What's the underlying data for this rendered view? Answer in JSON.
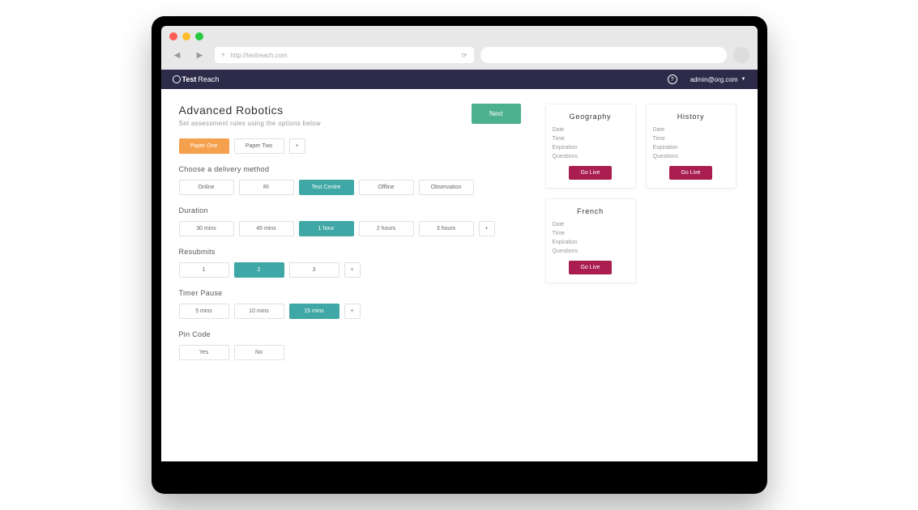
{
  "browser": {
    "url": "http://testreach.com"
  },
  "header": {
    "logo_bold": "Test",
    "logo_light": "Reach",
    "help": "?",
    "user": "admin@org.com"
  },
  "page": {
    "title": "Advanced Robotics",
    "subtitle": "Set assessment rules using the options below",
    "next_label": "Next"
  },
  "papers": {
    "items": [
      "Paper One",
      "Paper Two"
    ],
    "plus": "+",
    "selected": 0
  },
  "delivery": {
    "label": "Choose a delivery method",
    "items": [
      "Online",
      "RI",
      "Test Centre",
      "Offline",
      "Observation"
    ],
    "selected": 2
  },
  "duration": {
    "label": "Duration",
    "items": [
      "30 mins",
      "45 mins",
      "1 hour",
      "2 hours",
      "3 hours"
    ],
    "plus": "+",
    "selected": 2
  },
  "resubmits": {
    "label": "Resubmits",
    "items": [
      "1",
      "2",
      "3"
    ],
    "plus": "+",
    "selected": 1
  },
  "timer": {
    "label": "Timer Pause",
    "items": [
      "5 mins",
      "10 mins",
      "15 mins"
    ],
    "plus": "+",
    "selected": 2
  },
  "pin": {
    "label": "Pin Code",
    "items": [
      "Yes",
      "No"
    ]
  },
  "cards": [
    {
      "title": "Geography",
      "lines": [
        "Date",
        "Time",
        "Expiration",
        "Questions"
      ],
      "action": "Go Live"
    },
    {
      "title": "History",
      "lines": [
        "Date",
        "Time",
        "Expiration",
        "Questions"
      ],
      "action": "Go Live"
    },
    {
      "title": "French",
      "lines": [
        "Date",
        "Time",
        "Expiration",
        "Questions"
      ],
      "action": "Go Live"
    }
  ]
}
